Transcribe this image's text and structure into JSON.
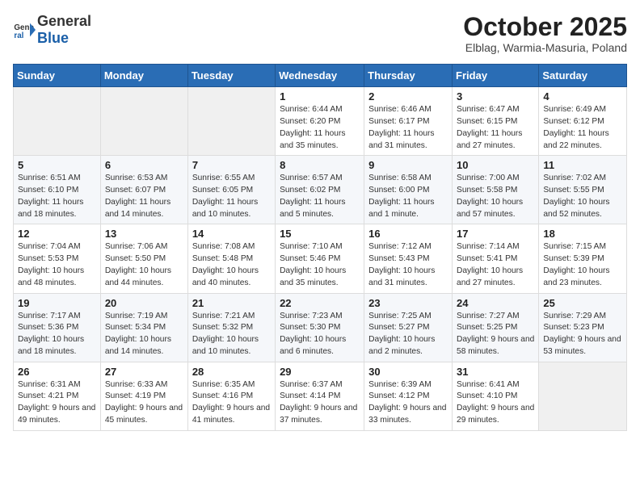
{
  "header": {
    "logo": {
      "text_general": "General",
      "text_blue": "Blue"
    },
    "month_title": "October 2025",
    "location": "Elblag, Warmia-Masuria, Poland"
  },
  "calendar": {
    "days_of_week": [
      "Sunday",
      "Monday",
      "Tuesday",
      "Wednesday",
      "Thursday",
      "Friday",
      "Saturday"
    ],
    "weeks": [
      [
        {
          "day": "",
          "info": ""
        },
        {
          "day": "",
          "info": ""
        },
        {
          "day": "",
          "info": ""
        },
        {
          "day": "1",
          "info": "Sunrise: 6:44 AM\nSunset: 6:20 PM\nDaylight: 11 hours and 35 minutes."
        },
        {
          "day": "2",
          "info": "Sunrise: 6:46 AM\nSunset: 6:17 PM\nDaylight: 11 hours and 31 minutes."
        },
        {
          "day": "3",
          "info": "Sunrise: 6:47 AM\nSunset: 6:15 PM\nDaylight: 11 hours and 27 minutes."
        },
        {
          "day": "4",
          "info": "Sunrise: 6:49 AM\nSunset: 6:12 PM\nDaylight: 11 hours and 22 minutes."
        }
      ],
      [
        {
          "day": "5",
          "info": "Sunrise: 6:51 AM\nSunset: 6:10 PM\nDaylight: 11 hours and 18 minutes."
        },
        {
          "day": "6",
          "info": "Sunrise: 6:53 AM\nSunset: 6:07 PM\nDaylight: 11 hours and 14 minutes."
        },
        {
          "day": "7",
          "info": "Sunrise: 6:55 AM\nSunset: 6:05 PM\nDaylight: 11 hours and 10 minutes."
        },
        {
          "day": "8",
          "info": "Sunrise: 6:57 AM\nSunset: 6:02 PM\nDaylight: 11 hours and 5 minutes."
        },
        {
          "day": "9",
          "info": "Sunrise: 6:58 AM\nSunset: 6:00 PM\nDaylight: 11 hours and 1 minute."
        },
        {
          "day": "10",
          "info": "Sunrise: 7:00 AM\nSunset: 5:58 PM\nDaylight: 10 hours and 57 minutes."
        },
        {
          "day": "11",
          "info": "Sunrise: 7:02 AM\nSunset: 5:55 PM\nDaylight: 10 hours and 52 minutes."
        }
      ],
      [
        {
          "day": "12",
          "info": "Sunrise: 7:04 AM\nSunset: 5:53 PM\nDaylight: 10 hours and 48 minutes."
        },
        {
          "day": "13",
          "info": "Sunrise: 7:06 AM\nSunset: 5:50 PM\nDaylight: 10 hours and 44 minutes."
        },
        {
          "day": "14",
          "info": "Sunrise: 7:08 AM\nSunset: 5:48 PM\nDaylight: 10 hours and 40 minutes."
        },
        {
          "day": "15",
          "info": "Sunrise: 7:10 AM\nSunset: 5:46 PM\nDaylight: 10 hours and 35 minutes."
        },
        {
          "day": "16",
          "info": "Sunrise: 7:12 AM\nSunset: 5:43 PM\nDaylight: 10 hours and 31 minutes."
        },
        {
          "day": "17",
          "info": "Sunrise: 7:14 AM\nSunset: 5:41 PM\nDaylight: 10 hours and 27 minutes."
        },
        {
          "day": "18",
          "info": "Sunrise: 7:15 AM\nSunset: 5:39 PM\nDaylight: 10 hours and 23 minutes."
        }
      ],
      [
        {
          "day": "19",
          "info": "Sunrise: 7:17 AM\nSunset: 5:36 PM\nDaylight: 10 hours and 18 minutes."
        },
        {
          "day": "20",
          "info": "Sunrise: 7:19 AM\nSunset: 5:34 PM\nDaylight: 10 hours and 14 minutes."
        },
        {
          "day": "21",
          "info": "Sunrise: 7:21 AM\nSunset: 5:32 PM\nDaylight: 10 hours and 10 minutes."
        },
        {
          "day": "22",
          "info": "Sunrise: 7:23 AM\nSunset: 5:30 PM\nDaylight: 10 hours and 6 minutes."
        },
        {
          "day": "23",
          "info": "Sunrise: 7:25 AM\nSunset: 5:27 PM\nDaylight: 10 hours and 2 minutes."
        },
        {
          "day": "24",
          "info": "Sunrise: 7:27 AM\nSunset: 5:25 PM\nDaylight: 9 hours and 58 minutes."
        },
        {
          "day": "25",
          "info": "Sunrise: 7:29 AM\nSunset: 5:23 PM\nDaylight: 9 hours and 53 minutes."
        }
      ],
      [
        {
          "day": "26",
          "info": "Sunrise: 6:31 AM\nSunset: 4:21 PM\nDaylight: 9 hours and 49 minutes."
        },
        {
          "day": "27",
          "info": "Sunrise: 6:33 AM\nSunset: 4:19 PM\nDaylight: 9 hours and 45 minutes."
        },
        {
          "day": "28",
          "info": "Sunrise: 6:35 AM\nSunset: 4:16 PM\nDaylight: 9 hours and 41 minutes."
        },
        {
          "day": "29",
          "info": "Sunrise: 6:37 AM\nSunset: 4:14 PM\nDaylight: 9 hours and 37 minutes."
        },
        {
          "day": "30",
          "info": "Sunrise: 6:39 AM\nSunset: 4:12 PM\nDaylight: 9 hours and 33 minutes."
        },
        {
          "day": "31",
          "info": "Sunrise: 6:41 AM\nSunset: 4:10 PM\nDaylight: 9 hours and 29 minutes."
        },
        {
          "day": "",
          "info": ""
        }
      ]
    ]
  }
}
